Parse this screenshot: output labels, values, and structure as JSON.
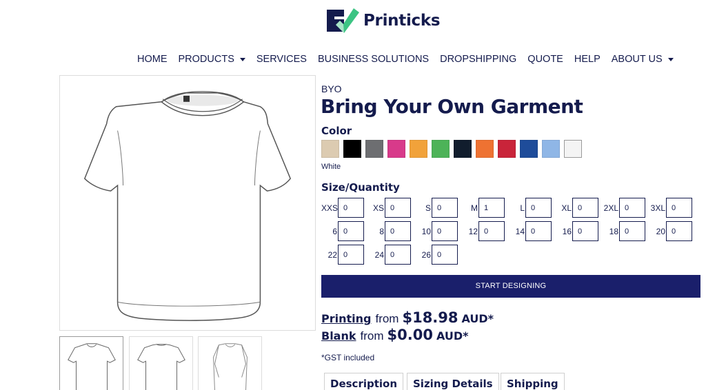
{
  "header": {
    "logo_text": "Printicks",
    "logo_colors": {
      "navy": "#141b4d",
      "green": "#3cc483"
    }
  },
  "nav": {
    "items": [
      {
        "label": "HOME",
        "has_dropdown": false
      },
      {
        "label": "PRODUCTS",
        "has_dropdown": true
      },
      {
        "label": "SERVICES",
        "has_dropdown": false
      },
      {
        "label": "BUSINESS SOLUTIONS",
        "has_dropdown": false
      },
      {
        "label": "DROPSHIPPING",
        "has_dropdown": false
      },
      {
        "label": "QUOTE",
        "has_dropdown": false
      },
      {
        "label": "HELP",
        "has_dropdown": false
      },
      {
        "label": "ABOUT US",
        "has_dropdown": true
      }
    ]
  },
  "gallery": {
    "main_image_icon": "tshirt-front-icon",
    "thumbnails": [
      {
        "icon": "tshirt-front-icon",
        "active": true
      },
      {
        "icon": "tshirt-back-icon",
        "active": false
      },
      {
        "icon": "tshirt-folded-icon",
        "active": false
      }
    ]
  },
  "product": {
    "brand": "BYO",
    "title": "Bring Your Own Garment",
    "color_label": "Color",
    "colors": [
      "#dccbb1",
      "#000000",
      "#6d6e71",
      "#d83a8a",
      "#f1a23a",
      "#4db358",
      "#111d2d",
      "#ee7232",
      "#c9243a",
      "#1e4c9a",
      "#8fb6e6",
      "#f4f4f4"
    ],
    "selected_color_index": 11,
    "selected_color_name": "White",
    "size_label": "Size/Quantity",
    "sizes": [
      {
        "label": "XXS",
        "qty": "0"
      },
      {
        "label": "XS",
        "qty": "0"
      },
      {
        "label": "S",
        "qty": "0"
      },
      {
        "label": "M",
        "qty": "1"
      },
      {
        "label": "L",
        "qty": "0"
      },
      {
        "label": "XL",
        "qty": "0"
      },
      {
        "label": "2XL",
        "qty": "0"
      },
      {
        "label": "3XL",
        "qty": "0"
      },
      {
        "label": "6",
        "qty": "0"
      },
      {
        "label": "8",
        "qty": "0"
      },
      {
        "label": "10",
        "qty": "0"
      },
      {
        "label": "12",
        "qty": "0"
      },
      {
        "label": "14",
        "qty": "0"
      },
      {
        "label": "16",
        "qty": "0"
      },
      {
        "label": "18",
        "qty": "0"
      },
      {
        "label": "20",
        "qty": "0"
      },
      {
        "label": "22",
        "qty": "0"
      },
      {
        "label": "24",
        "qty": "0"
      },
      {
        "label": "26",
        "qty": "0"
      }
    ],
    "cta_label": "START DESIGNING",
    "cta_color": "#1a1f6b",
    "pricing": {
      "printing_label": "Printing",
      "printing_from": "from",
      "printing_price": "$18.98",
      "printing_currency": "AUD*",
      "blank_label": "Blank",
      "blank_from": "from",
      "blank_price": "$0.00",
      "blank_currency": "AUD*"
    },
    "gst_note": "*GST included",
    "tabs": [
      "Description",
      "Sizing Details",
      "Shipping"
    ]
  }
}
